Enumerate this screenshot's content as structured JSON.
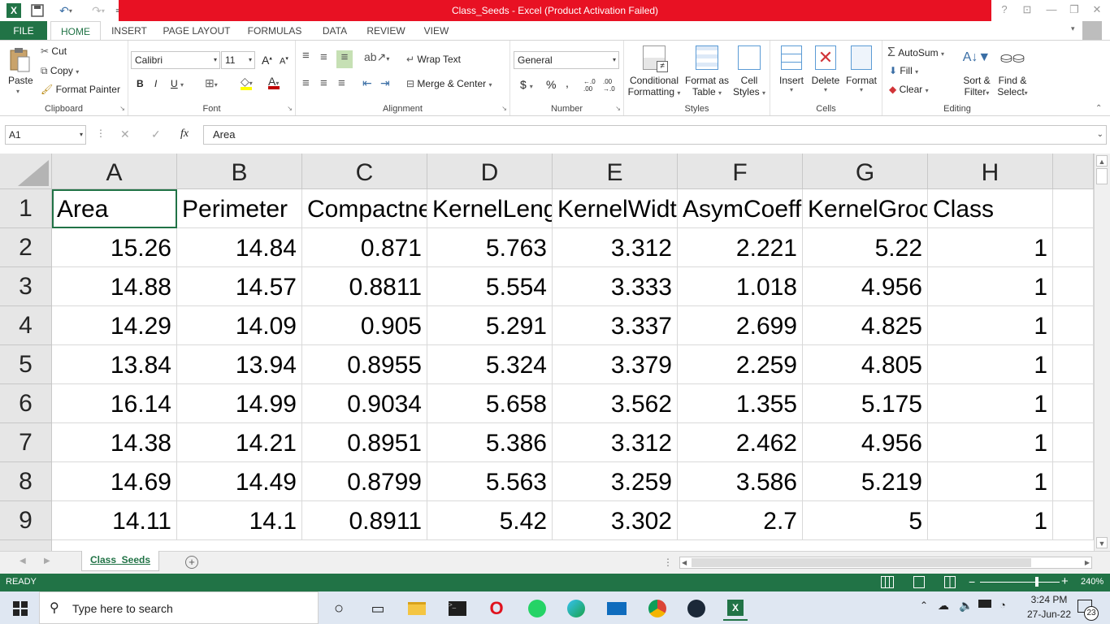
{
  "window": {
    "title": "Class_Seeds -  Excel (Product Activation Failed)",
    "help": "?",
    "minimize": "—",
    "restore": "❐",
    "close": "✕"
  },
  "tabs": [
    "FILE",
    "HOME",
    "INSERT",
    "PAGE LAYOUT",
    "FORMULAS",
    "DATA",
    "REVIEW",
    "VIEW"
  ],
  "ribbon": {
    "clipboard": {
      "paste": "Paste",
      "cut": "Cut",
      "copy": "Copy",
      "format_painter": "Format Painter",
      "label": "Clipboard"
    },
    "font": {
      "name": "Calibri",
      "size": "11",
      "bold": "B",
      "italic": "I",
      "underline": "U",
      "grow": "A",
      "shrink": "A",
      "label": "Font"
    },
    "alignment": {
      "wrap": "Wrap Text",
      "merge": "Merge & Center",
      "label": "Alignment"
    },
    "number": {
      "format": "General",
      "currency": "$",
      "percent": "%",
      "comma": ",",
      "inc_decimal": "←.0 .00",
      "dec_decimal": ".00 →.0",
      "label": "Number"
    },
    "styles": {
      "conditional": "Conditional",
      "conditional2": "Formatting",
      "format_table": "Format as",
      "format_table2": "Table",
      "cell_styles": "Cell",
      "cell_styles2": "Styles",
      "label": "Styles"
    },
    "cells": {
      "insert": "Insert",
      "delete": "Delete",
      "format": "Format",
      "label": "Cells"
    },
    "editing": {
      "autosum": "AutoSum",
      "fill": "Fill",
      "clear": "Clear",
      "sort": "Sort &",
      "sort2": "Filter",
      "find": "Find &",
      "find2": "Select",
      "label": "Editing"
    }
  },
  "formula_bar": {
    "name_box": "A1",
    "fx": "fx",
    "content": "Area"
  },
  "columns": [
    "A",
    "B",
    "C",
    "D",
    "E",
    "F",
    "G",
    "H"
  ],
  "rows": [
    "1",
    "2",
    "3",
    "4",
    "5",
    "6",
    "7",
    "8",
    "9"
  ],
  "header_row": [
    "Area",
    "Perimeter",
    "Compactness",
    "KernelLength",
    "KernelWidth",
    "AsymCoeff",
    "KernelGroove",
    "Class"
  ],
  "data_rows": [
    [
      "15.26",
      "14.84",
      "0.871",
      "5.763",
      "3.312",
      "2.221",
      "5.22",
      "1"
    ],
    [
      "14.88",
      "14.57",
      "0.8811",
      "5.554",
      "3.333",
      "1.018",
      "4.956",
      "1"
    ],
    [
      "14.29",
      "14.09",
      "0.905",
      "5.291",
      "3.337",
      "2.699",
      "4.825",
      "1"
    ],
    [
      "13.84",
      "13.94",
      "0.8955",
      "5.324",
      "3.379",
      "2.259",
      "4.805",
      "1"
    ],
    [
      "16.14",
      "14.99",
      "0.9034",
      "5.658",
      "3.562",
      "1.355",
      "5.175",
      "1"
    ],
    [
      "14.38",
      "14.21",
      "0.8951",
      "5.386",
      "3.312",
      "2.462",
      "4.956",
      "1"
    ],
    [
      "14.69",
      "14.49",
      "0.8799",
      "5.563",
      "3.259",
      "3.586",
      "5.219",
      "1"
    ],
    [
      "14.11",
      "14.1",
      "0.8911",
      "5.42",
      "3.302",
      "2.7",
      "5",
      "1"
    ]
  ],
  "sheet_tabs": [
    "Class_Seeds"
  ],
  "status": {
    "mode": "READY",
    "zoom": "240%"
  },
  "taskbar": {
    "search_placeholder": "Type here to search",
    "time": "3:24 PM",
    "date": "27-Jun-22",
    "notifications": "23"
  },
  "colors": {
    "excel_green": "#217346",
    "title_red": "#e81123"
  }
}
